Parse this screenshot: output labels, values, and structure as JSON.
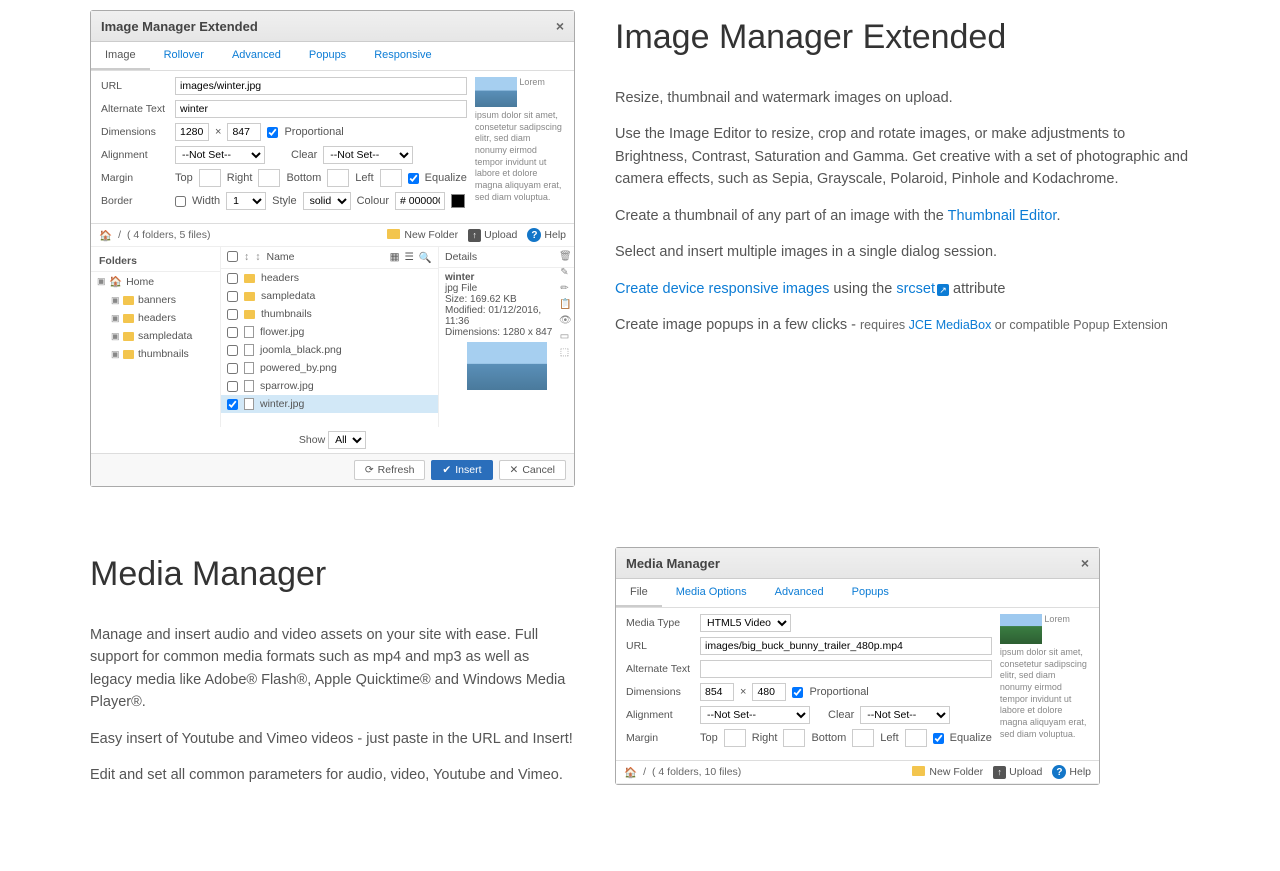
{
  "sec1": {
    "title": "Image Manager Extended",
    "p1": "Resize, thumbnail and watermark images on upload.",
    "p2": "Use the Image Editor to resize, crop and rotate images, or make adjustments to Brightness, Contrast, Saturation and Gamma. Get creative with a set of photographic and camera effects, such as Sepia, Grayscale, Polaroid, Pinhole and  Kodachrome.",
    "p3_a": "Create a thumbnail of any part of an image with the ",
    "p3_link": "Thumbnail Editor",
    "p3_b": ".",
    "p4": "Select and insert multiple images in a single dialog session.",
    "p5_link1": "Create device responsive images",
    "p5_mid": " using the ",
    "p5_link2": "srcset",
    "p5_end": " attribute",
    "p6_a": "Create image popups in a few clicks - ",
    "p6_req": "requires ",
    "p6_link": "JCE MediaBox",
    "p6_b": " or compatible Popup Extension"
  },
  "sec2": {
    "title": "Media Manager",
    "p1": "Manage and insert audio and video assets on your site with ease. Full support for  common media formats such as mp4 and mp3 as well as legacy media like Adobe® Flash®, Apple Quicktime® and Windows Media Player®.",
    "p2": "Easy insert of Youtube and Vimeo videos - just paste in the URL and Insert!",
    "p3": "Edit and set all common parameters for audio, video, Youtube and Vimeo."
  },
  "dlg1": {
    "title": "Image Manager Extended",
    "tabs": [
      "Image",
      "Rollover",
      "Advanced",
      "Popups",
      "Responsive"
    ],
    "labels": {
      "url": "URL",
      "alt": "Alternate Text",
      "dim": "Dimensions",
      "align": "Alignment",
      "margin": "Margin",
      "border": "Border",
      "clear": "Clear",
      "prop": "Proportional",
      "top": "Top",
      "right": "Right",
      "bottom": "Bottom",
      "left": "Left",
      "equal": "Equalize",
      "width": "Width",
      "style": "Style",
      "colour": "Colour"
    },
    "values": {
      "url": "images/winter.jpg",
      "alt": "winter",
      "w": "1280",
      "h": "847",
      "align": "--Not Set--",
      "clear": "--Not Set--",
      "borderW": "1",
      "borderS": "solid",
      "colour": "# 000000"
    },
    "lorem": "Lorem ipsum dolor sit amet, consetetur sadipscing elitr, sed diam nonumy eirmod tempor invidunt ut labore et dolore magna aliquyam erat, sed diam voluptua.",
    "crumb": "( 4 folders, 5 files)",
    "newfolder": "New Folder",
    "upload": "Upload",
    "help": "Help",
    "folders": "Folders",
    "name": "Name",
    "details": "Details",
    "home": "Home",
    "tree": [
      "banners",
      "headers",
      "sampledata",
      "thumbnails"
    ],
    "files": [
      {
        "t": "folder",
        "n": "headers"
      },
      {
        "t": "folder",
        "n": "sampledata"
      },
      {
        "t": "folder",
        "n": "thumbnails"
      },
      {
        "t": "file",
        "n": "flower.jpg"
      },
      {
        "t": "file",
        "n": "joomla_black.png"
      },
      {
        "t": "file",
        "n": "powered_by.png"
      },
      {
        "t": "file",
        "n": "sparrow.jpg"
      },
      {
        "t": "file",
        "n": "winter.jpg",
        "sel": true
      }
    ],
    "detail": {
      "name": "winter",
      "type": "jpg File",
      "size": "Size: 169.62 KB",
      "mod": "Modified: 01/12/2016, 11:36",
      "dims": "Dimensions: 1280 x 847"
    },
    "show": "Show",
    "all": "All",
    "refresh": "Refresh",
    "insert": "Insert",
    "cancel": "Cancel"
  },
  "dlg2": {
    "title": "Media Manager",
    "tabs": [
      "File",
      "Media Options",
      "Advanced",
      "Popups"
    ],
    "labels": {
      "mtype": "Media Type",
      "url": "URL",
      "alt": "Alternate Text",
      "dim": "Dimensions",
      "align": "Alignment",
      "margin": "Margin",
      "clear": "Clear",
      "prop": "Proportional",
      "top": "Top",
      "right": "Right",
      "bottom": "Bottom",
      "left": "Left",
      "equal": "Equalize"
    },
    "values": {
      "mtype": "HTML5 Video",
      "url": "images/big_buck_bunny_trailer_480p.mp4",
      "w": "854",
      "h": "480",
      "align": "--Not Set--",
      "clear": "--Not Set--"
    },
    "lorem": "Lorem ipsum dolor sit amet, consetetur sadipscing elitr, sed diam nonumy eirmod tempor invidunt ut labore et dolore magna aliquyam erat, sed diam voluptua.",
    "crumb": "( 4 folders, 10 files)",
    "newfolder": "New Folder",
    "upload": "Upload",
    "help": "Help"
  }
}
